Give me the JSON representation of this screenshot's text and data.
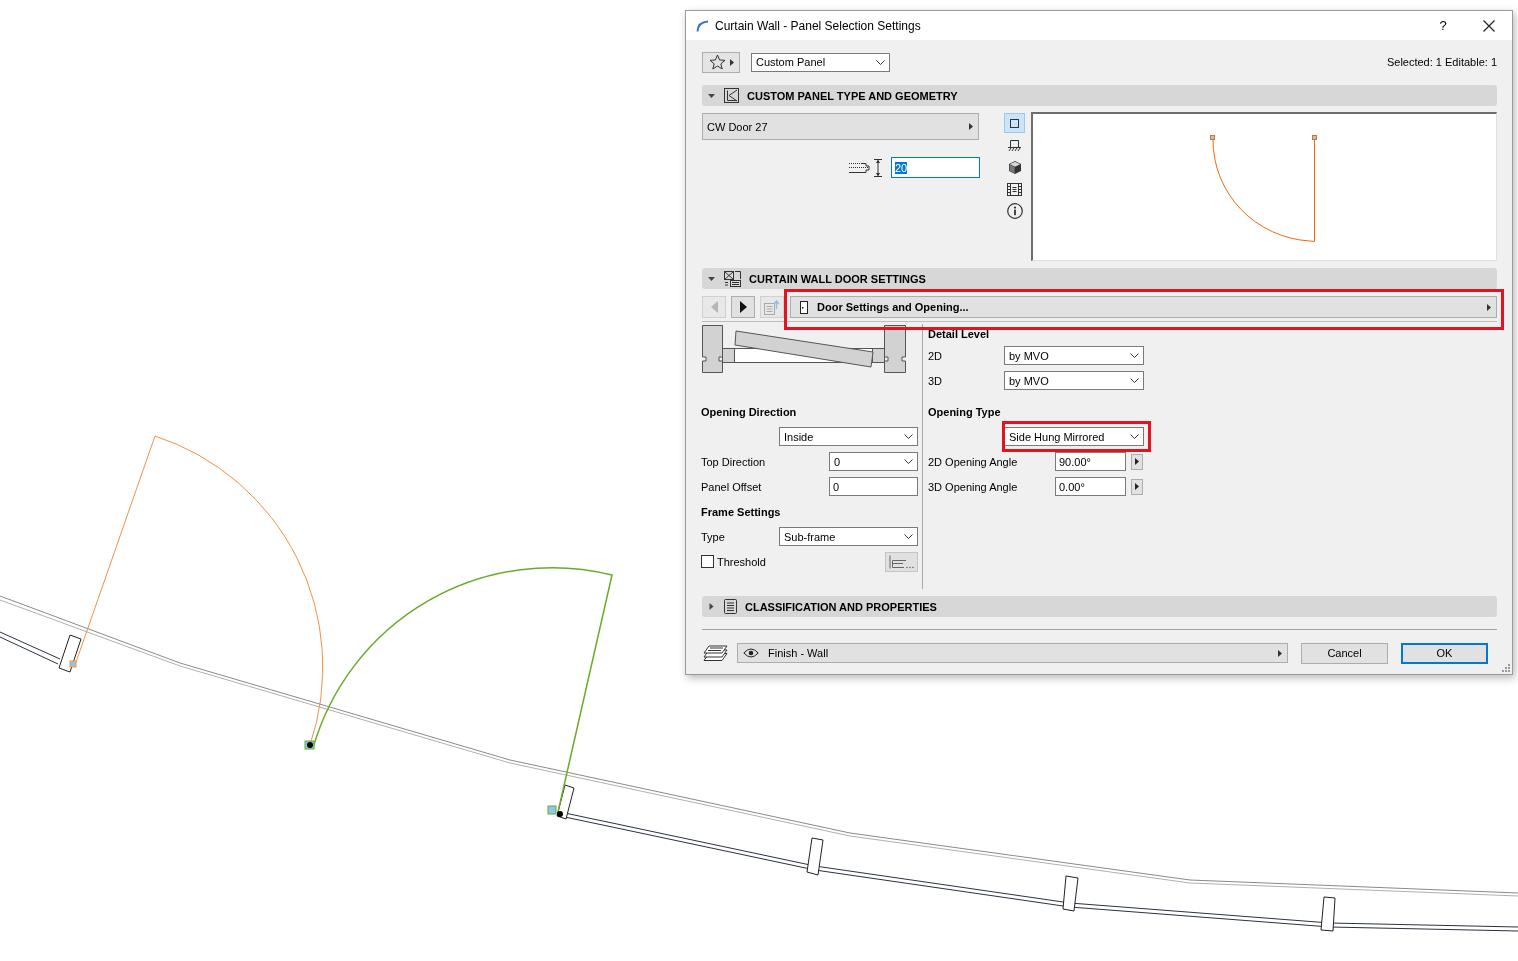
{
  "window": {
    "title": "Curtain Wall - Panel Selection Settings",
    "help": "?"
  },
  "header": {
    "preset": "Custom Panel",
    "selection_info": "Selected: 1 Editable: 1"
  },
  "sections": [
    {
      "kind": "geometry",
      "title": "CUSTOM PANEL TYPE AND GEOMETRY",
      "expanded": true,
      "panel_type": "CW Door 27",
      "thickness": {
        "value": "20",
        "text_selected": true
      },
      "view_modes": [
        {
          "kind": "plan",
          "selected": true
        },
        {
          "kind": "section",
          "selected": false
        },
        {
          "kind": "model",
          "selected": false
        },
        {
          "kind": "list",
          "selected": false
        },
        {
          "kind": "info",
          "selected": false
        }
      ]
    },
    {
      "kind": "door",
      "title": "CURTAIN WALL DOOR SETTINGS",
      "expanded": true,
      "nav": [
        {
          "kind": "prev",
          "disabled": true
        },
        {
          "kind": "next",
          "disabled": false
        },
        {
          "kind": "export",
          "disabled": true
        }
      ],
      "page": {
        "label": "Door Settings and Opening...",
        "highlighted": true
      },
      "left": [
        {
          "kind": "heading",
          "label": "Opening Direction"
        },
        {
          "kind": "dropdown",
          "value": "Inside",
          "highlighted": false
        },
        {
          "kind": "dropdown",
          "label": "Top Direction",
          "value": "0",
          "highlighted": false
        },
        {
          "kind": "input",
          "label": "Panel Offset",
          "value": "0",
          "highlighted": false
        },
        {
          "kind": "heading",
          "label": "Frame Settings"
        },
        {
          "kind": "dropdown",
          "label": "Type",
          "value": "Sub-frame",
          "highlighted": false
        },
        {
          "kind": "checkbox",
          "label": "Threshold",
          "checked": false
        }
      ],
      "right": [
        {
          "kind": "heading",
          "label": "Detail Level"
        },
        {
          "kind": "dropdown",
          "label": "2D",
          "value": "by MVO",
          "highlighted": false
        },
        {
          "kind": "dropdown",
          "label": "3D",
          "value": "by MVO",
          "highlighted": false
        },
        {
          "kind": "heading",
          "label": "Opening Type"
        },
        {
          "kind": "dropdown",
          "value": "Side Hung Mirrored",
          "highlighted": true
        },
        {
          "kind": "angle",
          "label": "2D Opening Angle",
          "value": "90.00°",
          "highlighted": false
        },
        {
          "kind": "angle",
          "label": "3D Opening Angle",
          "value": "0.00°",
          "highlighted": false
        }
      ]
    },
    {
      "kind": "classification",
      "title": "CLASSIFICATION AND PROPERTIES",
      "expanded": false
    }
  ],
  "footer": {
    "layer": "Finish - Wall",
    "buttons": [
      {
        "label": "Cancel",
        "default": false
      },
      {
        "label": "OK",
        "default": true
      }
    ]
  }
}
